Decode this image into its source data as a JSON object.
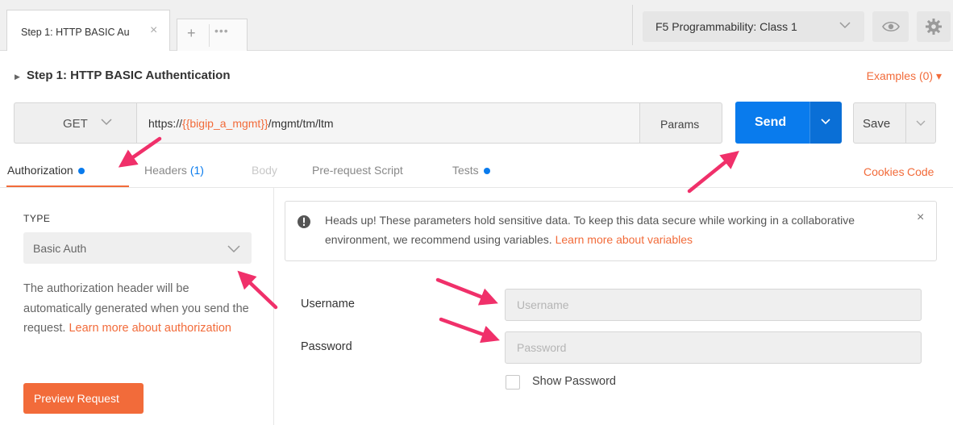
{
  "tabs": {
    "active_label": "Step 1: HTTP BASIC Au",
    "close_icon": "close-icon",
    "add_icon": "plus-icon",
    "more_icon": "more-dots-icon"
  },
  "environment": {
    "selected": "F5 Programmability: Class 1",
    "eye_icon": "eye-icon",
    "gear_icon": "gear-icon"
  },
  "request": {
    "title": "Step 1: HTTP BASIC Authentication",
    "examples_label": "Examples (0) ▾",
    "method": "GET",
    "url_prefix": "https://",
    "url_variable": "{{bigip_a_mgmt}}",
    "url_suffix": "/mgmt/tm/ltm",
    "params_label": "Params",
    "send_label": "Send",
    "save_label": "Save"
  },
  "subtabs": {
    "authorization": "Authorization",
    "headers": "Headers",
    "headers_count": "(1)",
    "body": "Body",
    "pre_request": "Pre-request Script",
    "tests": "Tests",
    "cookies": "Cookies",
    "code": "Code"
  },
  "auth": {
    "type_label": "TYPE",
    "type_value": "Basic Auth",
    "description": "The authorization header will be automatically generated when you send the request.",
    "learn_more": "Learn more about authorization",
    "preview_label": "Preview Request"
  },
  "notice": {
    "text": "Heads up! These parameters hold sensitive data. To keep this data secure while working in a collaborative environment, we recommend using variables.",
    "link": "Learn more about variables",
    "close": "×"
  },
  "form": {
    "username_label": "Username",
    "username_placeholder": "Username",
    "username_value": "",
    "password_label": "Password",
    "password_placeholder": "Password",
    "password_value": "",
    "show_password_label": "Show Password",
    "show_password_checked": false
  },
  "colors": {
    "accent": "#f26b3a",
    "primary": "#097bed",
    "annotation_arrow": "#f0306a"
  }
}
